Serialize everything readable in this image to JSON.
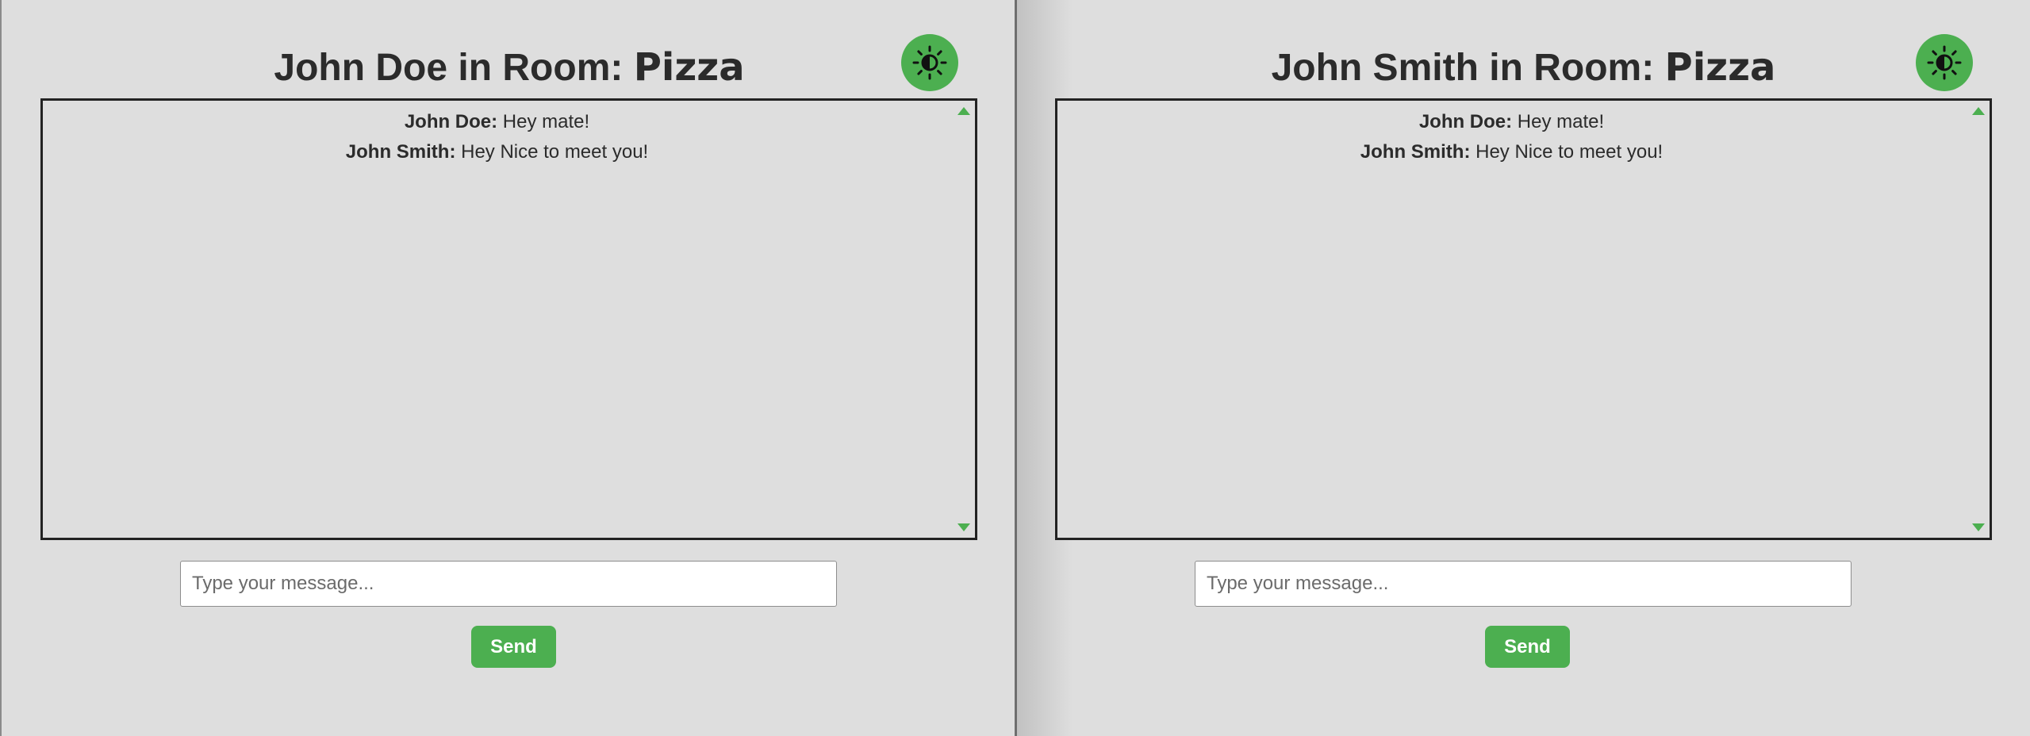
{
  "colors": {
    "background": "#dedede",
    "accent": "#4caf50",
    "text": "#2b2b2b",
    "border": "#222222"
  },
  "panes": [
    {
      "user": "John Doe",
      "room_prefix": " in Room: ",
      "room": "Pizza",
      "theme_toggle_icon": "contrast-sun-icon",
      "messages": [
        {
          "sender": "John Doe:",
          "text": " Hey mate!"
        },
        {
          "sender": "John Smith:",
          "text": " Hey Nice to meet you!"
        }
      ],
      "input_placeholder": "Type your message...",
      "input_value": "",
      "send_label": "Send"
    },
    {
      "user": "John Smith",
      "room_prefix": " in Room: ",
      "room": "Pizza",
      "theme_toggle_icon": "contrast-sun-icon",
      "messages": [
        {
          "sender": "John Doe:",
          "text": " Hey mate!"
        },
        {
          "sender": "John Smith:",
          "text": " Hey Nice to meet you!"
        }
      ],
      "input_placeholder": "Type your message...",
      "input_value": "",
      "send_label": "Send"
    }
  ]
}
